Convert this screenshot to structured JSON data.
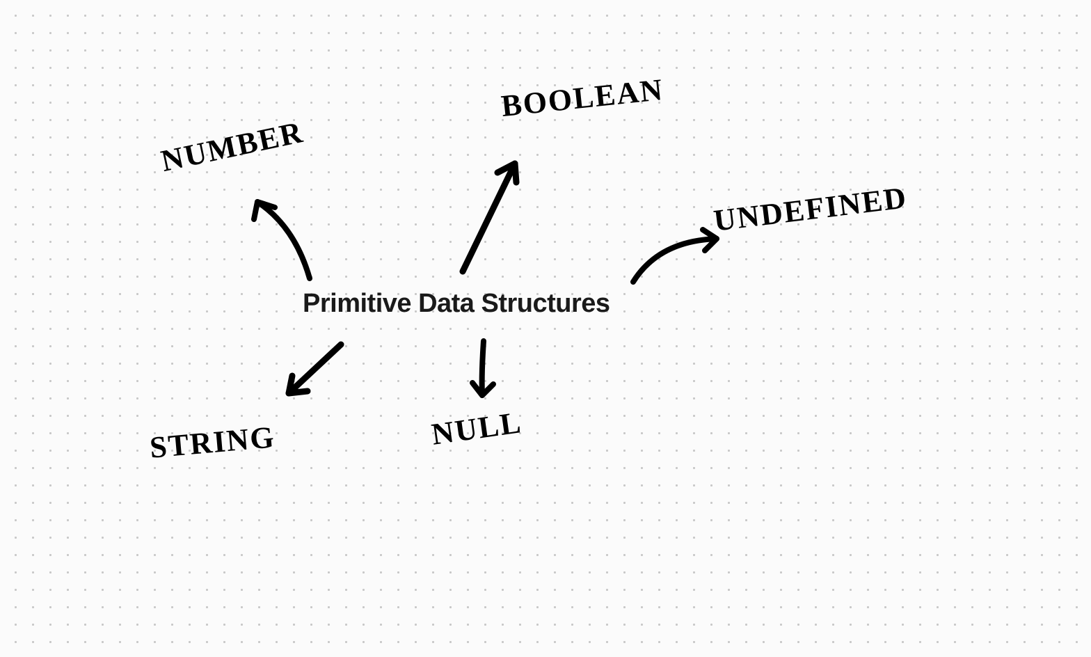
{
  "diagram": {
    "title": "Primitive Data Structures",
    "nodes": {
      "number": "NUMBER",
      "boolean": "BOOLEAN",
      "undefined": "UNDEFINED",
      "string": "STRING",
      "null": "NULL"
    },
    "arrows": [
      {
        "from": "center",
        "to": "number"
      },
      {
        "from": "center",
        "to": "boolean"
      },
      {
        "from": "center",
        "to": "undefined"
      },
      {
        "from": "center",
        "to": "string"
      },
      {
        "from": "center",
        "to": "null"
      }
    ]
  }
}
